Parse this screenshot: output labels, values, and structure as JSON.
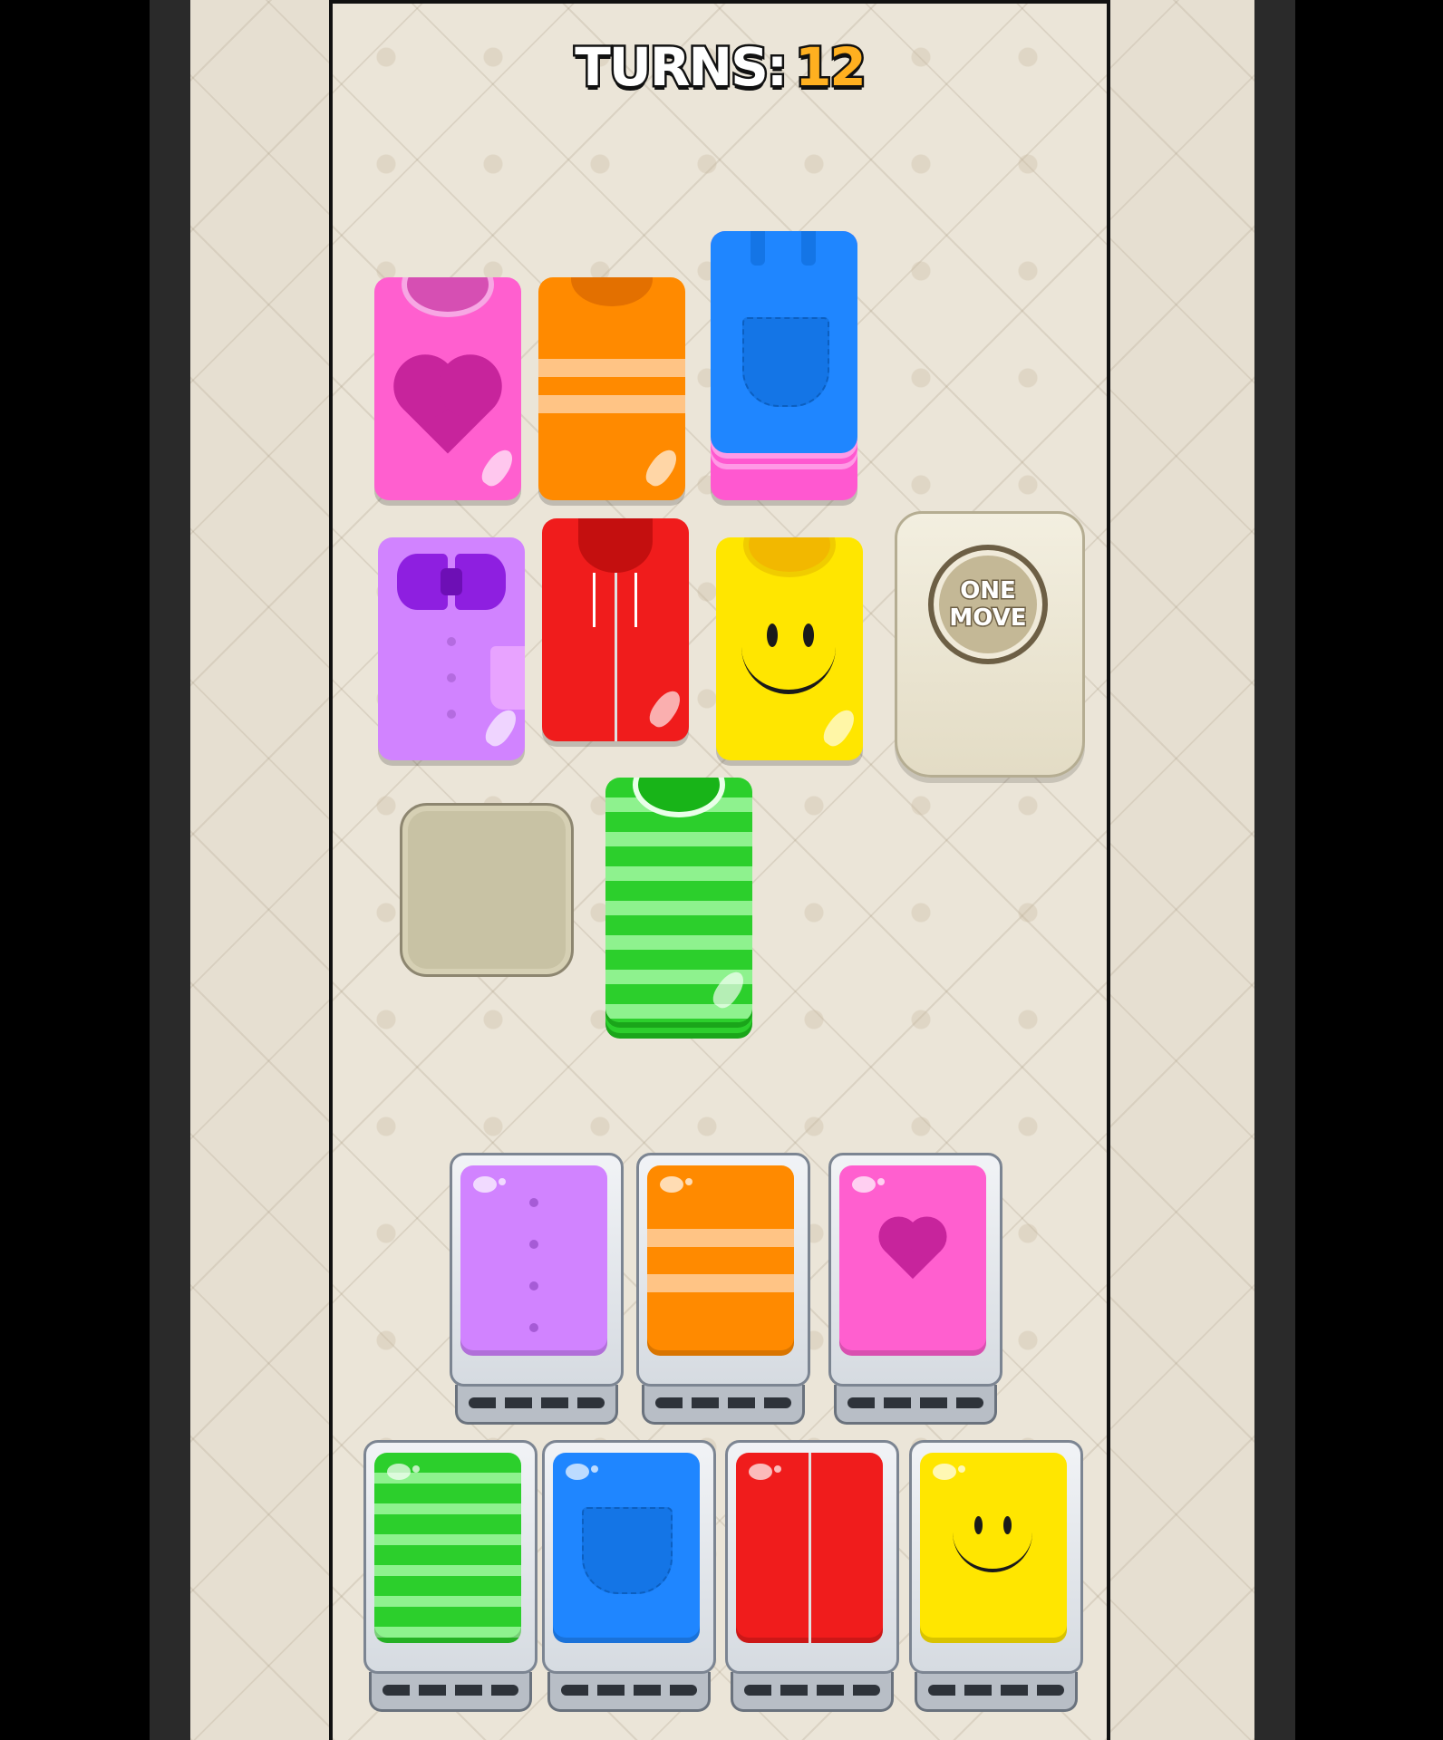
{
  "hud": {
    "turns_label": "TURNS:",
    "turns_value": "12"
  },
  "board": {
    "clothes": [
      {
        "name": "pink-heart-sweater",
        "color": "#ff5fcf"
      },
      {
        "name": "orange-zigzag-sweater",
        "color": "#ff8a00"
      },
      {
        "name": "blue-jeans-stack",
        "color": "#1f86ff"
      },
      {
        "name": "purple-bow-shirt",
        "color": "#d183ff"
      },
      {
        "name": "red-hoodie",
        "color": "#f01c1c"
      },
      {
        "name": "yellow-smiley-sweater",
        "color": "#ffe600"
      },
      {
        "name": "green-striped-shirt-stack",
        "color": "#2ccf2c"
      }
    ],
    "locked_tile": {
      "line1": "ONE",
      "line2": "MOVE"
    }
  },
  "bins": [
    {
      "name": "purple-bin",
      "color": "#d183ff"
    },
    {
      "name": "orange-bin",
      "color": "#ff8a00"
    },
    {
      "name": "pink-bin",
      "color": "#ff5fcf"
    },
    {
      "name": "green-bin",
      "color": "#2ccf2c"
    },
    {
      "name": "blue-bin",
      "color": "#1f86ff"
    },
    {
      "name": "red-bin",
      "color": "#f01c1c"
    },
    {
      "name": "yellow-bin",
      "color": "#ffe600"
    }
  ]
}
